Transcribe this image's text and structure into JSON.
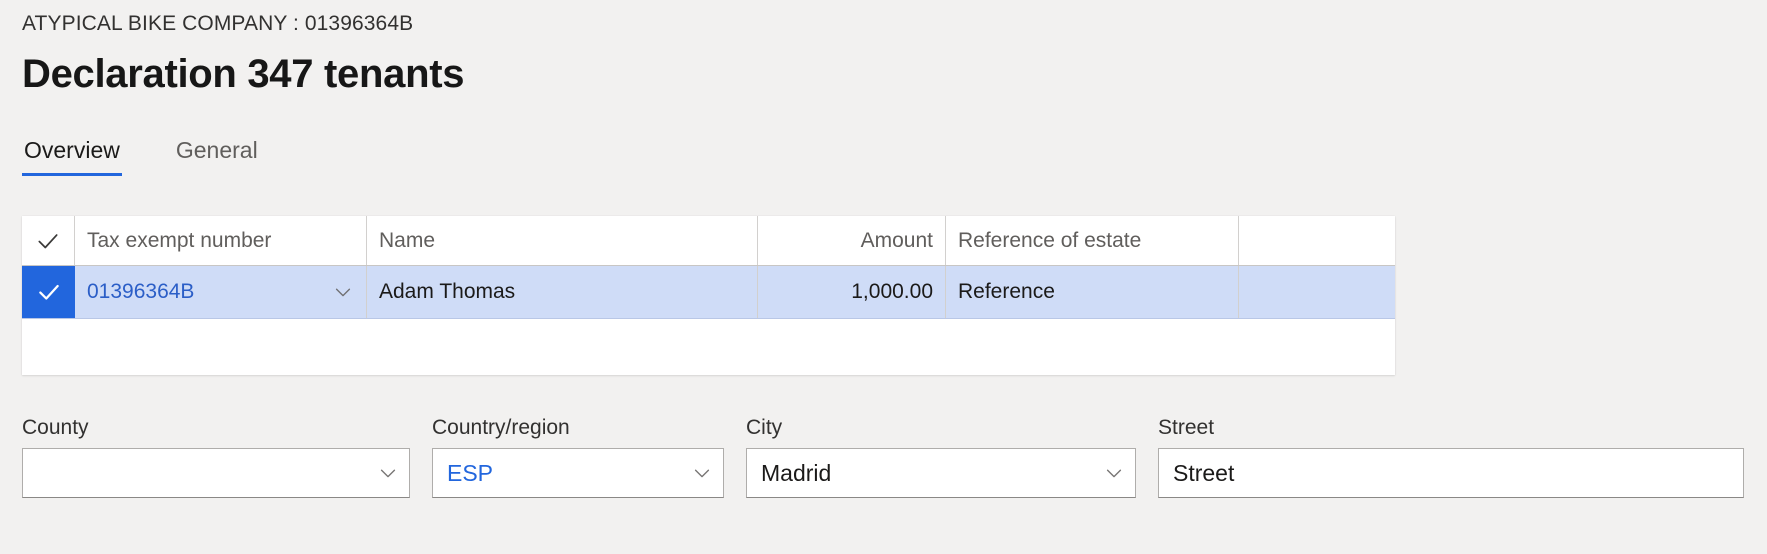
{
  "header": {
    "breadcrumb": "ATYPICAL BIKE COMPANY : 01396364B",
    "title": "Declaration 347 tenants"
  },
  "tabs": [
    {
      "label": "Overview",
      "active": true
    },
    {
      "label": "General",
      "active": false
    }
  ],
  "grid": {
    "columns": [
      {
        "key": "select",
        "label": "",
        "icon": "checkmark-icon"
      },
      {
        "key": "tax_exempt_number",
        "label": "Tax exempt number"
      },
      {
        "key": "name",
        "label": "Name"
      },
      {
        "key": "amount",
        "label": "Amount",
        "align": "right"
      },
      {
        "key": "reference_of_estate",
        "label": "Reference of estate"
      }
    ],
    "rows": [
      {
        "selected": true,
        "tax_exempt_number": "01396364B",
        "name": "Adam Thomas",
        "amount": "1,000.00",
        "reference_of_estate": "Reference"
      }
    ]
  },
  "form": {
    "fields": [
      {
        "name": "county",
        "label": "County",
        "value": "",
        "has_dropdown": true,
        "accent": false
      },
      {
        "name": "country",
        "label": "Country/region",
        "value": "ESP",
        "has_dropdown": true,
        "accent": true
      },
      {
        "name": "city",
        "label": "City",
        "value": "Madrid",
        "has_dropdown": true,
        "accent": false
      },
      {
        "name": "street",
        "label": "Street",
        "value": "Street",
        "has_dropdown": false,
        "accent": false
      }
    ]
  },
  "colors": {
    "accent": "#2266dd",
    "selected_row": "#cfdcf7",
    "link": "#2b5ec7",
    "page_background": "#f2f1f0"
  }
}
